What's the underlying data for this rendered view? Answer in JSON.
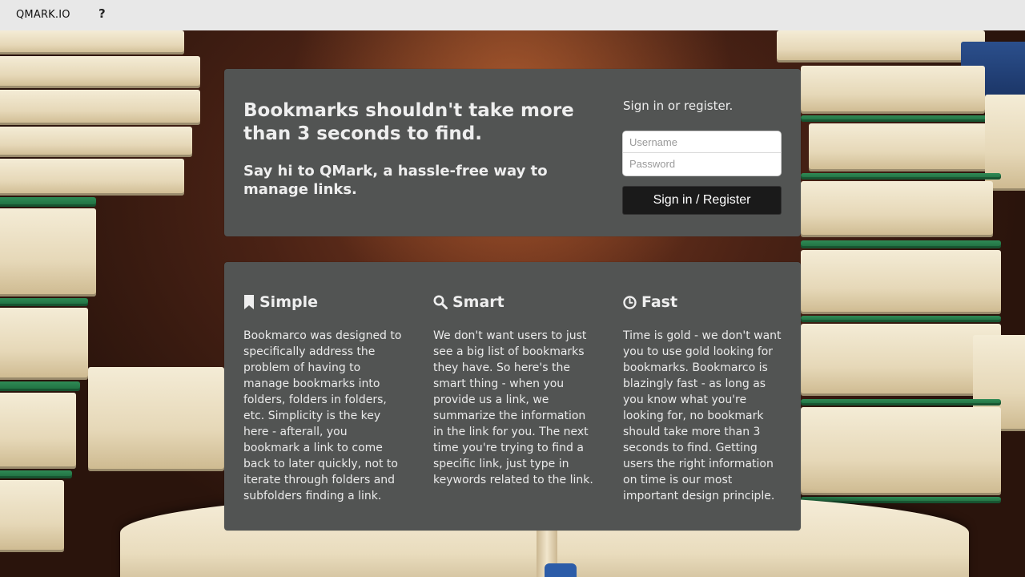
{
  "nav": {
    "brand": "QMARK.IO",
    "help_label": "?"
  },
  "hero": {
    "headline": "Bookmarks shouldn't take more than 3 seconds to find.",
    "subheadline": "Say hi to QMark, a hassle-free way to manage links."
  },
  "signin": {
    "title": "Sign in or register.",
    "username_placeholder": "Username",
    "password_placeholder": "Password",
    "button_label": "Sign in / Register"
  },
  "features": [
    {
      "icon": "bookmark-icon",
      "title": "Simple",
      "text": "Bookmarco was designed to specifically address the problem of having to manage bookmarks into folders, folders in folders, etc. Simplicity is the key here - afterall, you bookmark a link to come back to later quickly, not to iterate through folders and subfolders finding a link."
    },
    {
      "icon": "search-icon",
      "title": "Smart",
      "text": "We don't want users to just see a big list of bookmarks they have. So here's the smart thing - when you provide us a link, we summarize the information in the link for you. The next time you're trying to find a specific link, just type in keywords related to the link."
    },
    {
      "icon": "clock-icon",
      "title": "Fast",
      "text": "Time is gold - we don't want you to use gold looking for bookmarks. Bookmarco is blazingly fast - as long as you know what you're looking for, no bookmark should take more than 3 seconds to find. Getting users the right information on time is our most important design principle."
    }
  ],
  "colors": {
    "panel": "#525453",
    "nav": "#e8e8e8",
    "button": "#1a1a1a"
  }
}
